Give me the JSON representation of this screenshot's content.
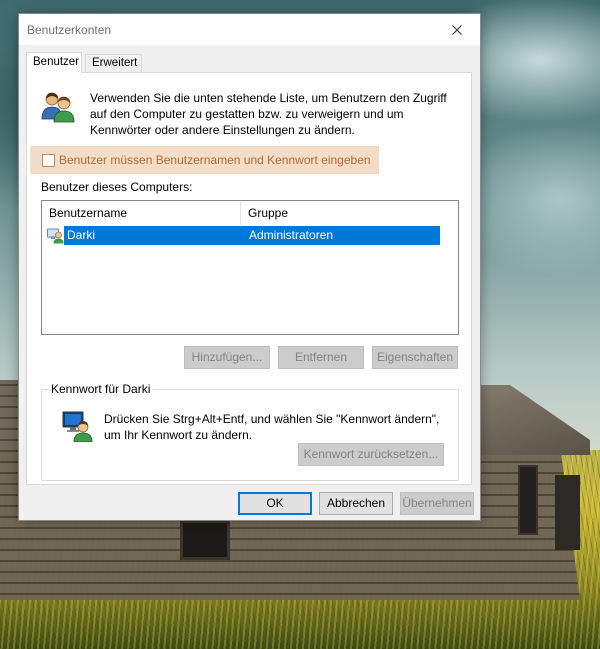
{
  "window": {
    "title": "Benutzerkonten",
    "close_icon": "close-icon"
  },
  "tabs": [
    {
      "label": "Benutzer",
      "active": true
    },
    {
      "label": "Erweitert",
      "active": false
    }
  ],
  "intro": {
    "icon": "users-icon",
    "text": "Verwenden Sie die unten stehende Liste, um Benutzern den Zugriff auf den Computer zu gestatten bzw. zu verweigern und um Kennwörter oder andere Einstellungen zu ändern."
  },
  "require_login": {
    "label": "Benutzer müssen Benutzernamen und Kennwort eingeben",
    "checked": false,
    "highlight_color": "#f3ddc8"
  },
  "users": {
    "label": "Benutzer dieses Computers:",
    "columns": [
      "Benutzername",
      "Gruppe"
    ],
    "rows": [
      {
        "username": "Darki",
        "group": "Administratoren",
        "selected": true
      }
    ],
    "selection_color": "#0078d7"
  },
  "user_buttons": {
    "add": "Hinzufügen...",
    "remove": "Entfernen",
    "properties": "Eigenschaften"
  },
  "password": {
    "group_label": "Kennwort für Darki",
    "icon": "user-password-icon",
    "text": "Drücken Sie Strg+Alt+Entf, und wählen Sie \"Kennwort ändern\", um Ihr Kennwort zu ändern.",
    "reset_button": "Kennwort zurücksetzen..."
  },
  "footer": {
    "ok": "OK",
    "cancel": "Abbrechen",
    "apply": "Übernehmen"
  }
}
